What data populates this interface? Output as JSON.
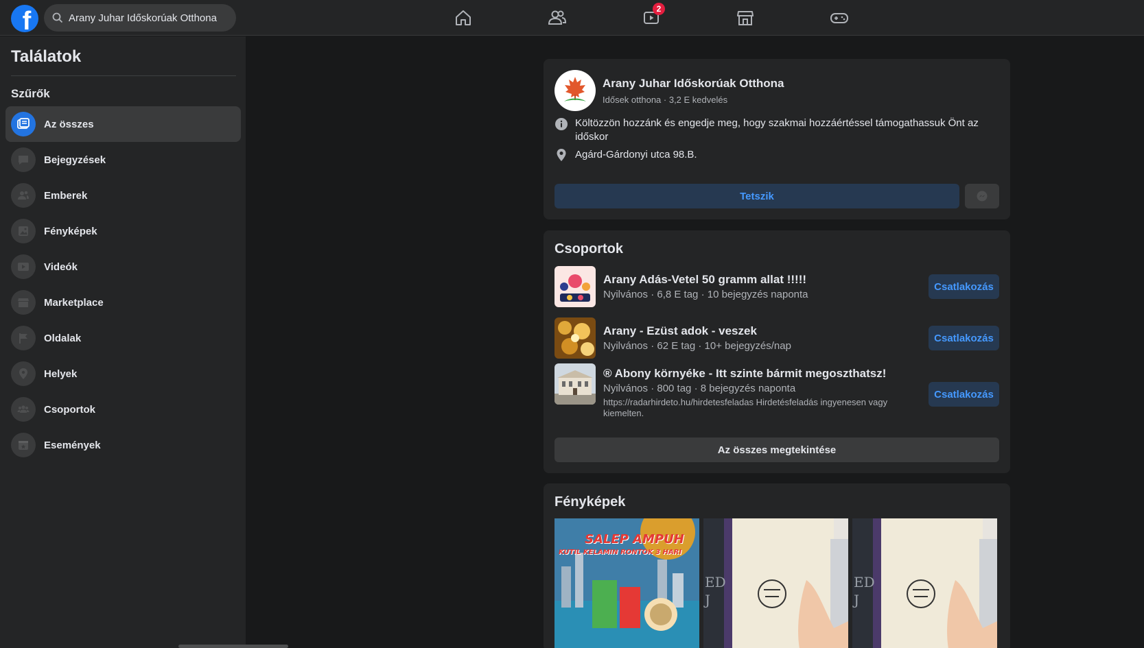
{
  "topbar": {
    "logo_letter": "f",
    "search_value": "Arany Juhar Időskorúak Otthona",
    "video_badge": "2",
    "nav": [
      "home-icon",
      "friends-icon",
      "watch-icon",
      "marketplace-icon",
      "gaming-icon"
    ]
  },
  "sidebar": {
    "title": "Találatok",
    "filters_label": "Szűrők",
    "items": [
      {
        "label": "Az összes",
        "icon": "all-results-icon"
      },
      {
        "label": "Bejegyzések",
        "icon": "posts-icon"
      },
      {
        "label": "Emberek",
        "icon": "people-icon"
      },
      {
        "label": "Fényképek",
        "icon": "photos-icon"
      },
      {
        "label": "Videók",
        "icon": "videos-icon"
      },
      {
        "label": "Marketplace",
        "icon": "marketplace-icon"
      },
      {
        "label": "Oldalak",
        "icon": "pages-icon"
      },
      {
        "label": "Helyek",
        "icon": "places-icon"
      },
      {
        "label": "Csoportok",
        "icon": "groups-icon"
      },
      {
        "label": "Események",
        "icon": "events-icon"
      }
    ]
  },
  "page_result": {
    "name": "Arany Juhar Időskorúak Otthona",
    "meta": "Idősek otthona · 3,2 E kedvelés",
    "about": "Költözzön hozzánk és engedje meg, hogy szakmai hozzáértéssel támogathassuk Önt az időskor",
    "address": "Agárd-Gárdonyi utca 98.B.",
    "like_label": "Tetszik"
  },
  "groups": {
    "title": "Csoportok",
    "items": [
      {
        "name": "Arany Adás-Vetel 50 gramm allat !!!!!",
        "meta": "Nyilvános · 6,8 E tag · 10 bejegyzés naponta",
        "desc": "",
        "join": "Csatlakozás"
      },
      {
        "name": "Arany - Ezüst adok - veszek",
        "meta": "Nyilvános · 62 E tag · 10+ bejegyzés/nap",
        "desc": "",
        "join": "Csatlakozás"
      },
      {
        "name": "® Abony környéke - Itt szinte bármit megoszthatsz!",
        "meta": "Nyilvános · 800 tag · 8 bejegyzés naponta",
        "desc": "https://radarhirdeto.hu/hirdetesfeladas Hirdetésfeladás ingyenesen vagy kiemelten.",
        "join": "Csatlakozás"
      }
    ],
    "see_all": "Az összes megtekintése"
  },
  "photos": {
    "title": "Fényképek",
    "photo1_headline": "SALEP AMPUH",
    "photo1_sub": "KUTIL KELAMIN RONTOK 3 HARI",
    "photo2_text": "ED J",
    "photo3_text": "ED J"
  }
}
